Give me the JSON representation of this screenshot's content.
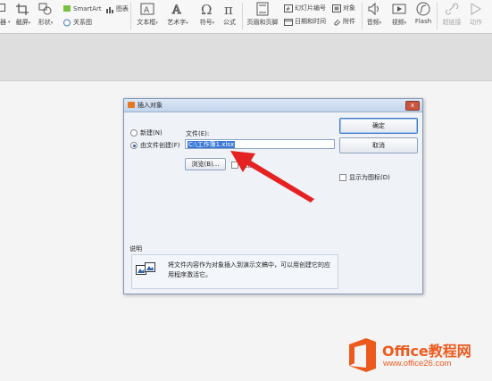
{
  "ribbon": {
    "item_cut_left": "器",
    "item_screenshot": "截屏",
    "item_shape": "形状",
    "item_smartart": "SmartArt",
    "item_chart": "图表",
    "item_relation": "关系图",
    "item_textbox": "文本框",
    "item_arttext": "艺术字",
    "item_symbol": "符号",
    "item_formula": "公式",
    "item_header_footer": "页眉和页脚",
    "item_slide_number": "幻灯片编号",
    "item_object": "对象",
    "item_datetime": "日期和时间",
    "item_attachment": "附件",
    "item_audio": "音频",
    "item_video": "视频",
    "item_flash": "Flash",
    "item_hyperlink": "超链接",
    "item_action": "动作"
  },
  "dialog": {
    "title": "插入对象",
    "close_label": "x",
    "radio_new": "新建(N)",
    "radio_from_file": "由文件创建(F)",
    "file_label": "文件(E):",
    "file_value": "C:\\工作簿1.xlsx",
    "browse_button": "浏览(B)...",
    "link_checkbox": "链接",
    "ok_button": "确定",
    "cancel_button": "取消",
    "display_icon_checkbox": "显示为图标(D)",
    "desc_title": "说明",
    "desc_text": "将文件内容作为对象插入到演示文稿中，可以用创建它的应用程序激活它。"
  },
  "watermark": {
    "name": "Office教程网",
    "url": "www.office26.com"
  },
  "colors": {
    "arrow": "#e52222",
    "accent": "#ed5a1e",
    "selection": "#3a78d6"
  }
}
